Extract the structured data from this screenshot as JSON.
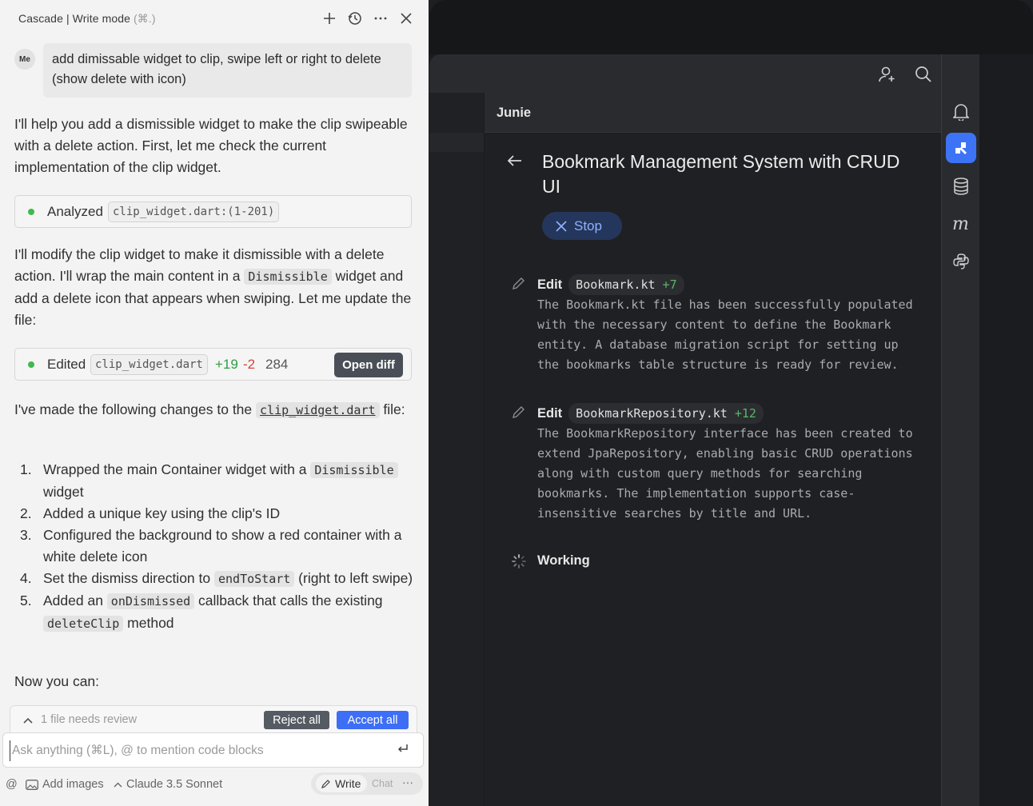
{
  "cascade": {
    "header": {
      "title": "Cascade | Write mode",
      "shortcut": "(⌘.)"
    },
    "user": {
      "avatar": "Me",
      "message": "add dimissable widget to clip, swipe left or right to delete (show delete with icon)"
    },
    "para1": "I'll help you add a dismissible widget to make the clip swipeable with a delete action. First, let me check the current implementation of the clip widget.",
    "analyzed": {
      "label": "Analyzed",
      "file": "clip_widget.dart:(1-201)"
    },
    "para2_a": "I'll modify the clip widget to make it dismissible with a delete action. I'll wrap the main content in a ",
    "para2_code": "Dismissible",
    "para2_b": " widget and add a delete icon that appears when swiping. Let me update the file:",
    "edited": {
      "label": "Edited",
      "file": "clip_widget.dart",
      "added": "+19",
      "removed": "-2",
      "count": "284",
      "open_diff": "Open diff"
    },
    "para3_a": "I've made the following changes to the ",
    "para3_code": "clip_widget.dart",
    "para3_b": " file:",
    "steps": [
      {
        "n": "1.",
        "a": "Wrapped the main Container widget with a ",
        "code": "Dismissible",
        "b": " widget"
      },
      {
        "n": "2.",
        "a": "Added a unique key using the clip's ID",
        "code": "",
        "b": ""
      },
      {
        "n": "3.",
        "a": "Configured the background to show a red container with a white delete icon",
        "code": "",
        "b": ""
      },
      {
        "n": "4.",
        "a": "Set the dismiss direction to ",
        "code": "endToStart",
        "b": " (right to left swipe)"
      },
      {
        "n": "5.",
        "a": "Added an ",
        "code": "onDismissed",
        "b": " callback that calls the existing ",
        "code2": "deleteClip",
        "c": " method"
      }
    ],
    "now_you_can": "Now you can:",
    "review": {
      "text": "1 file needs review",
      "reject": "Reject all",
      "accept": "Accept all"
    },
    "input": {
      "placeholder": "Ask anything (⌘L), @ to mention code blocks"
    },
    "footer": {
      "at": "@",
      "add_images": "Add images",
      "model": "Claude 3.5 Sonnet",
      "write": "Write",
      "chat": "Chat",
      "more": "···"
    }
  },
  "junie": {
    "panel_title": "Junie",
    "task_title": "Bookmark Management System with CRUD UI",
    "stop": "Stop",
    "steps": [
      {
        "verb": "Edit",
        "file": "Bookmark.kt",
        "added": "+7",
        "desc": "The Bookmark.kt file has been successfully populated with the necessary content to define the Bookmark entity. A database migration script for setting up the bookmarks table structure is ready for review."
      },
      {
        "verb": "Edit",
        "file": "BookmarkRepository.kt",
        "added": "+12",
        "desc": "The BookmarkRepository interface has been created to extend JpaRepository, enabling basic CRUD operations along with custom query methods for searching bookmarks. The implementation supports case-insensitive searches by title and URL."
      }
    ],
    "working": "Working"
  },
  "colors": {
    "accent": "#3d74f5",
    "added": "#58b66a",
    "removed": "#d8413a",
    "stop_text": "#8fb2ff"
  }
}
